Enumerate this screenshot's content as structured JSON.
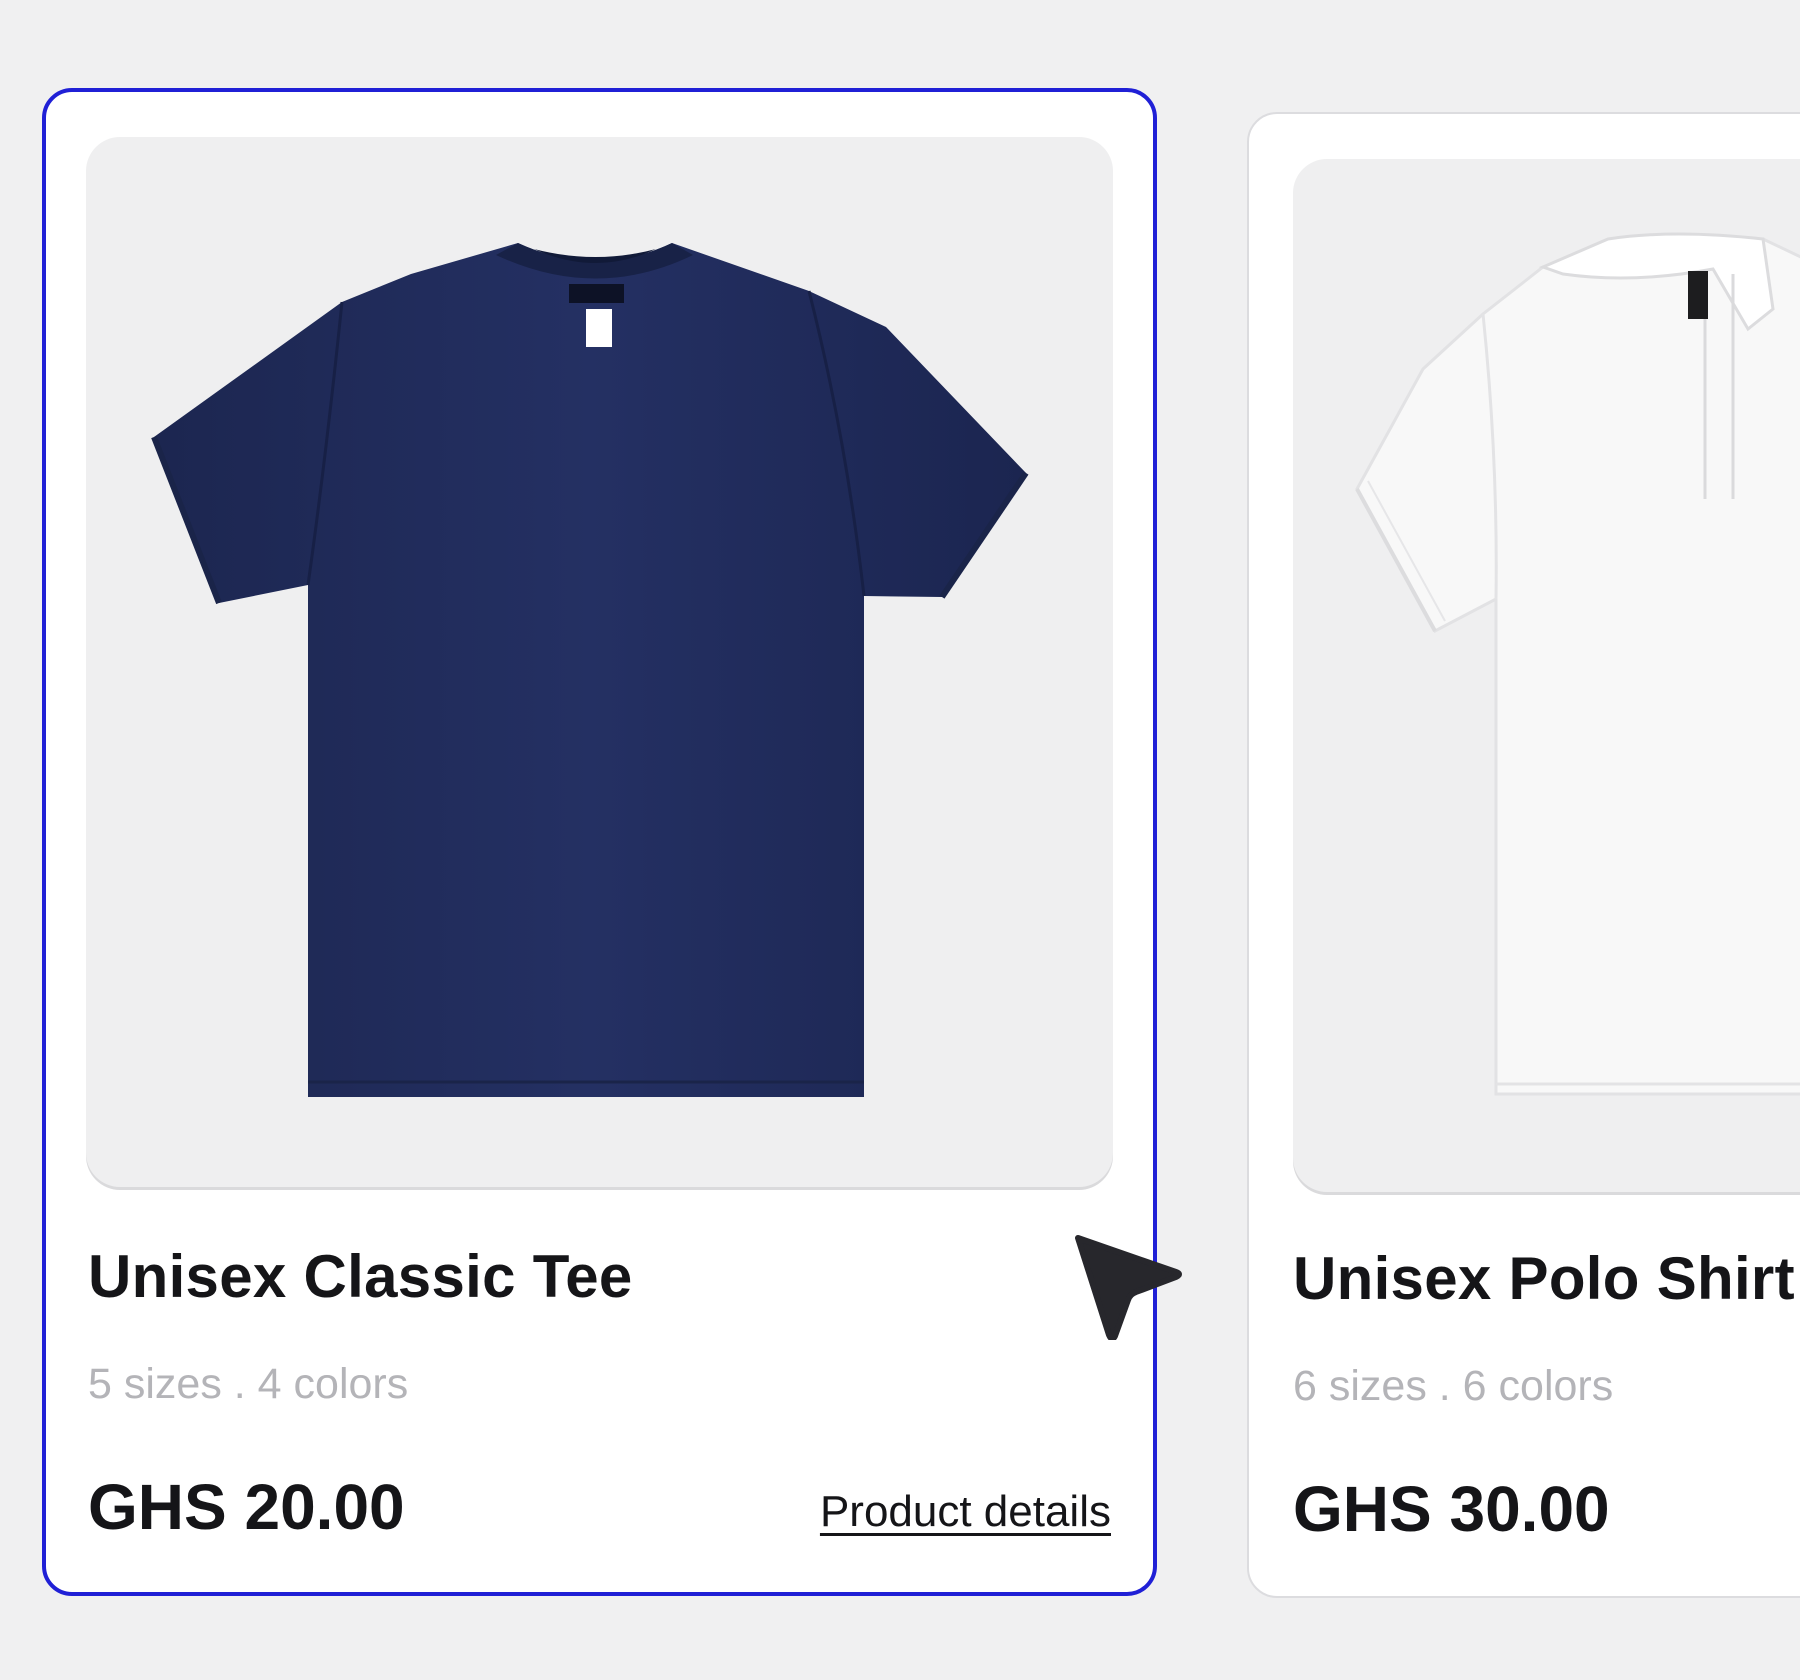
{
  "products": [
    {
      "image_icon": "navy-tshirt-image",
      "title": "Unisex Classic Tee",
      "meta": "5 sizes . 4 colors",
      "price": "GHS 20.00",
      "details_label": "Product details",
      "selected": true,
      "shirt_color": "#1f2a55"
    },
    {
      "image_icon": "white-polo-shirt-image",
      "title": "Unisex Polo Shirt",
      "meta": "6 sizes . 6 colors",
      "price": "GHS 30.00",
      "shirt_color": "#f7f7f7"
    }
  ],
  "colors": {
    "selected_border": "#2020d6",
    "background": "#f0f0f1",
    "card": "#ffffff",
    "image_bg": "#efeff0"
  },
  "cursor_icon": "pointer-arrow-icon"
}
